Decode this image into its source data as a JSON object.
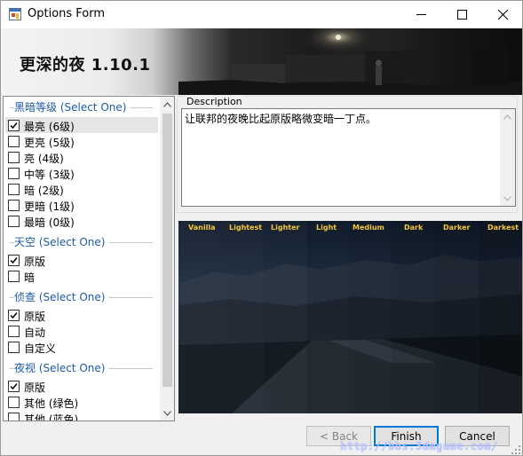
{
  "window": {
    "title": "Options Form"
  },
  "banner": {
    "title": "更深的夜 1.10.1"
  },
  "options": {
    "groups": [
      {
        "label": "黑暗等级 (Select One)",
        "items": [
          {
            "label": "最亮 (6级)",
            "checked": true,
            "selected": true
          },
          {
            "label": "更亮 (5级)",
            "checked": false
          },
          {
            "label": "亮 (4级)",
            "checked": false
          },
          {
            "label": "中等 (3级)",
            "checked": false
          },
          {
            "label": "暗 (2级)",
            "checked": false
          },
          {
            "label": "更暗 (1级)",
            "checked": false
          },
          {
            "label": "最暗 (0级)",
            "checked": false
          }
        ]
      },
      {
        "label": "天空 (Select One)",
        "items": [
          {
            "label": "原版",
            "checked": true
          },
          {
            "label": "暗",
            "checked": false
          }
        ]
      },
      {
        "label": "侦查 (Select One)",
        "items": [
          {
            "label": "原版",
            "checked": true
          },
          {
            "label": "自动",
            "checked": false
          },
          {
            "label": "自定义",
            "checked": false
          }
        ]
      },
      {
        "label": "夜视 (Select One)",
        "items": [
          {
            "label": "原版",
            "checked": true
          },
          {
            "label": "其他 (绿色)",
            "checked": false
          },
          {
            "label": "其他 (蓝色)",
            "checked": false
          }
        ]
      }
    ]
  },
  "description": {
    "legend": "Description",
    "text": "让联邦的夜晚比起原版略微变暗一丁点。"
  },
  "preview": {
    "labels": [
      "Vanilla",
      "Lightest",
      "Lighter",
      "Light",
      "Medium",
      "Dark",
      "Darker",
      "Darkest"
    ],
    "label_color": "#f3c63a"
  },
  "buttons": {
    "back": "< Back",
    "finish": "Finish",
    "cancel": "Cancel"
  },
  "watermark": "http://bbs.3dmgame.com/",
  "colors": {
    "group_label": "#1d5aa9",
    "default_button_border": "#0078d7"
  }
}
